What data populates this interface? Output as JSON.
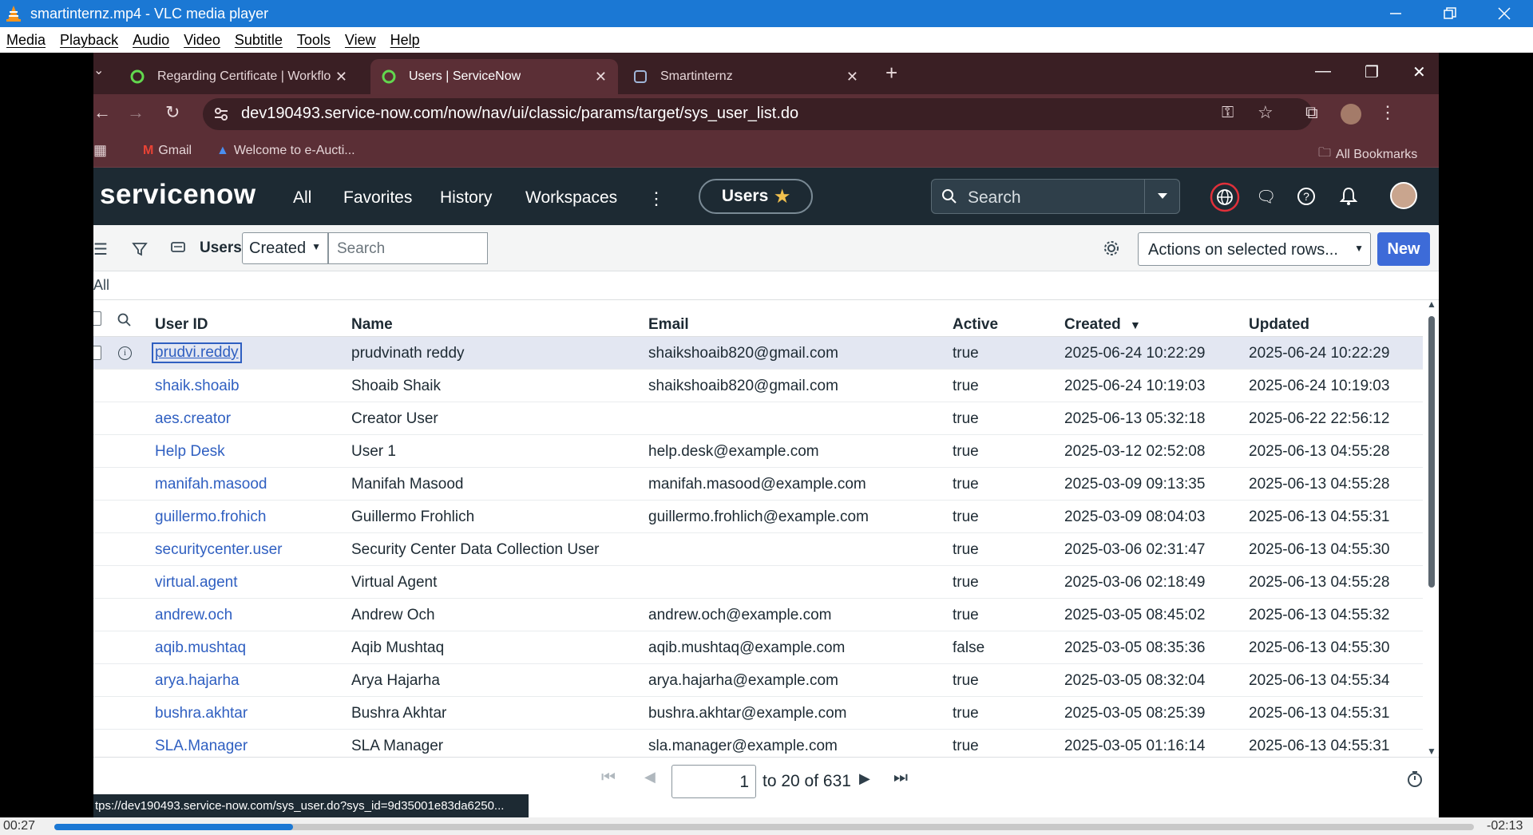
{
  "vlc": {
    "window_title": "smartinternz.mp4 - VLC media player",
    "menu": [
      "Media",
      "Playback",
      "Audio",
      "Video",
      "Subtitle",
      "Tools",
      "View",
      "Help"
    ],
    "time_elapsed": "00:27",
    "time_remaining": "-02:13",
    "progress": 0.168
  },
  "browser": {
    "tabs": [
      {
        "label": "Regarding Certificate | Workflo",
        "close": "✕"
      },
      {
        "label": "Users | ServiceNow",
        "close": "✕"
      },
      {
        "label": "Smartinternz",
        "close": "✕"
      }
    ],
    "new_tab": "+",
    "url": "dev190493.service-now.com/now/nav/ui/classic/params/target/sys_user_list.do",
    "bookmarks": [
      "Gmail",
      "Welcome to e-Aucti..."
    ],
    "all_bookmarks": "All Bookmarks",
    "status_url": "tps://dev190493.service-now.com/sys_user.do?sys_id=9d35001e83da6250..."
  },
  "servicenow": {
    "logo": "servicenow",
    "nav": [
      "All",
      "Favorites",
      "History",
      "Workspaces"
    ],
    "users_pill": "Users",
    "search_placeholder": "Search"
  },
  "list": {
    "title": "Users",
    "filter_field": "Created",
    "search_placeholder": "Search",
    "actions": "Actions on selected rows...",
    "new_label": "New",
    "breadcrumb": "All",
    "columns": [
      "User ID",
      "Name",
      "Email",
      "Active",
      "Created",
      "Updated"
    ],
    "rows": [
      [
        "prudvi.reddy",
        "prudvinath reddy",
        "shaikshoaib820@gmail.com",
        "true",
        "2025-06-24 10:22:29",
        "2025-06-24 10:22:29"
      ],
      [
        "shaik.shoaib",
        "Shoaib Shaik",
        "shaikshoaib820@gmail.com",
        "true",
        "2025-06-24 10:19:03",
        "2025-06-24 10:19:03"
      ],
      [
        "aes.creator",
        "Creator User",
        "",
        "true",
        "2025-06-13 05:32:18",
        "2025-06-22 22:56:12"
      ],
      [
        "Help Desk",
        "User 1",
        "help.desk@example.com",
        "true",
        "2025-03-12 02:52:08",
        "2025-06-13 04:55:28"
      ],
      [
        "manifah.masood",
        "Manifah Masood",
        "manifah.masood@example.com",
        "true",
        "2025-03-09 09:13:35",
        "2025-06-13 04:55:28"
      ],
      [
        "guillermo.frohich",
        "Guillermo Frohlich",
        "guillermo.frohlich@example.com",
        "true",
        "2025-03-09 08:04:03",
        "2025-06-13 04:55:31"
      ],
      [
        "securitycenter.user",
        "Security Center Data Collection User",
        "",
        "true",
        "2025-03-06 02:31:47",
        "2025-06-13 04:55:30"
      ],
      [
        "virtual.agent",
        "Virtual Agent",
        "",
        "true",
        "2025-03-06 02:18:49",
        "2025-06-13 04:55:28"
      ],
      [
        "andrew.och",
        "Andrew Och",
        "andrew.och@example.com",
        "true",
        "2025-03-05 08:45:02",
        "2025-06-13 04:55:32"
      ],
      [
        "aqib.mushtaq",
        "Aqib Mushtaq",
        "aqib.mushtaq@example.com",
        "false",
        "2025-03-05 08:35:36",
        "2025-06-13 04:55:30"
      ],
      [
        "arya.hajarha",
        "Arya Hajarha",
        "arya.hajarha@example.com",
        "true",
        "2025-03-05 08:32:04",
        "2025-06-13 04:55:34"
      ],
      [
        "bushra.akhtar",
        "Bushra Akhtar",
        "bushra.akhtar@example.com",
        "true",
        "2025-03-05 08:25:39",
        "2025-06-13 04:55:31"
      ],
      [
        "SLA.Manager",
        "SLA Manager",
        "sla.manager@example.com",
        "true",
        "2025-03-05 01:16:14",
        "2025-06-13 04:55:31"
      ]
    ],
    "page_number": "1",
    "page_range": "to 20 of 631"
  }
}
